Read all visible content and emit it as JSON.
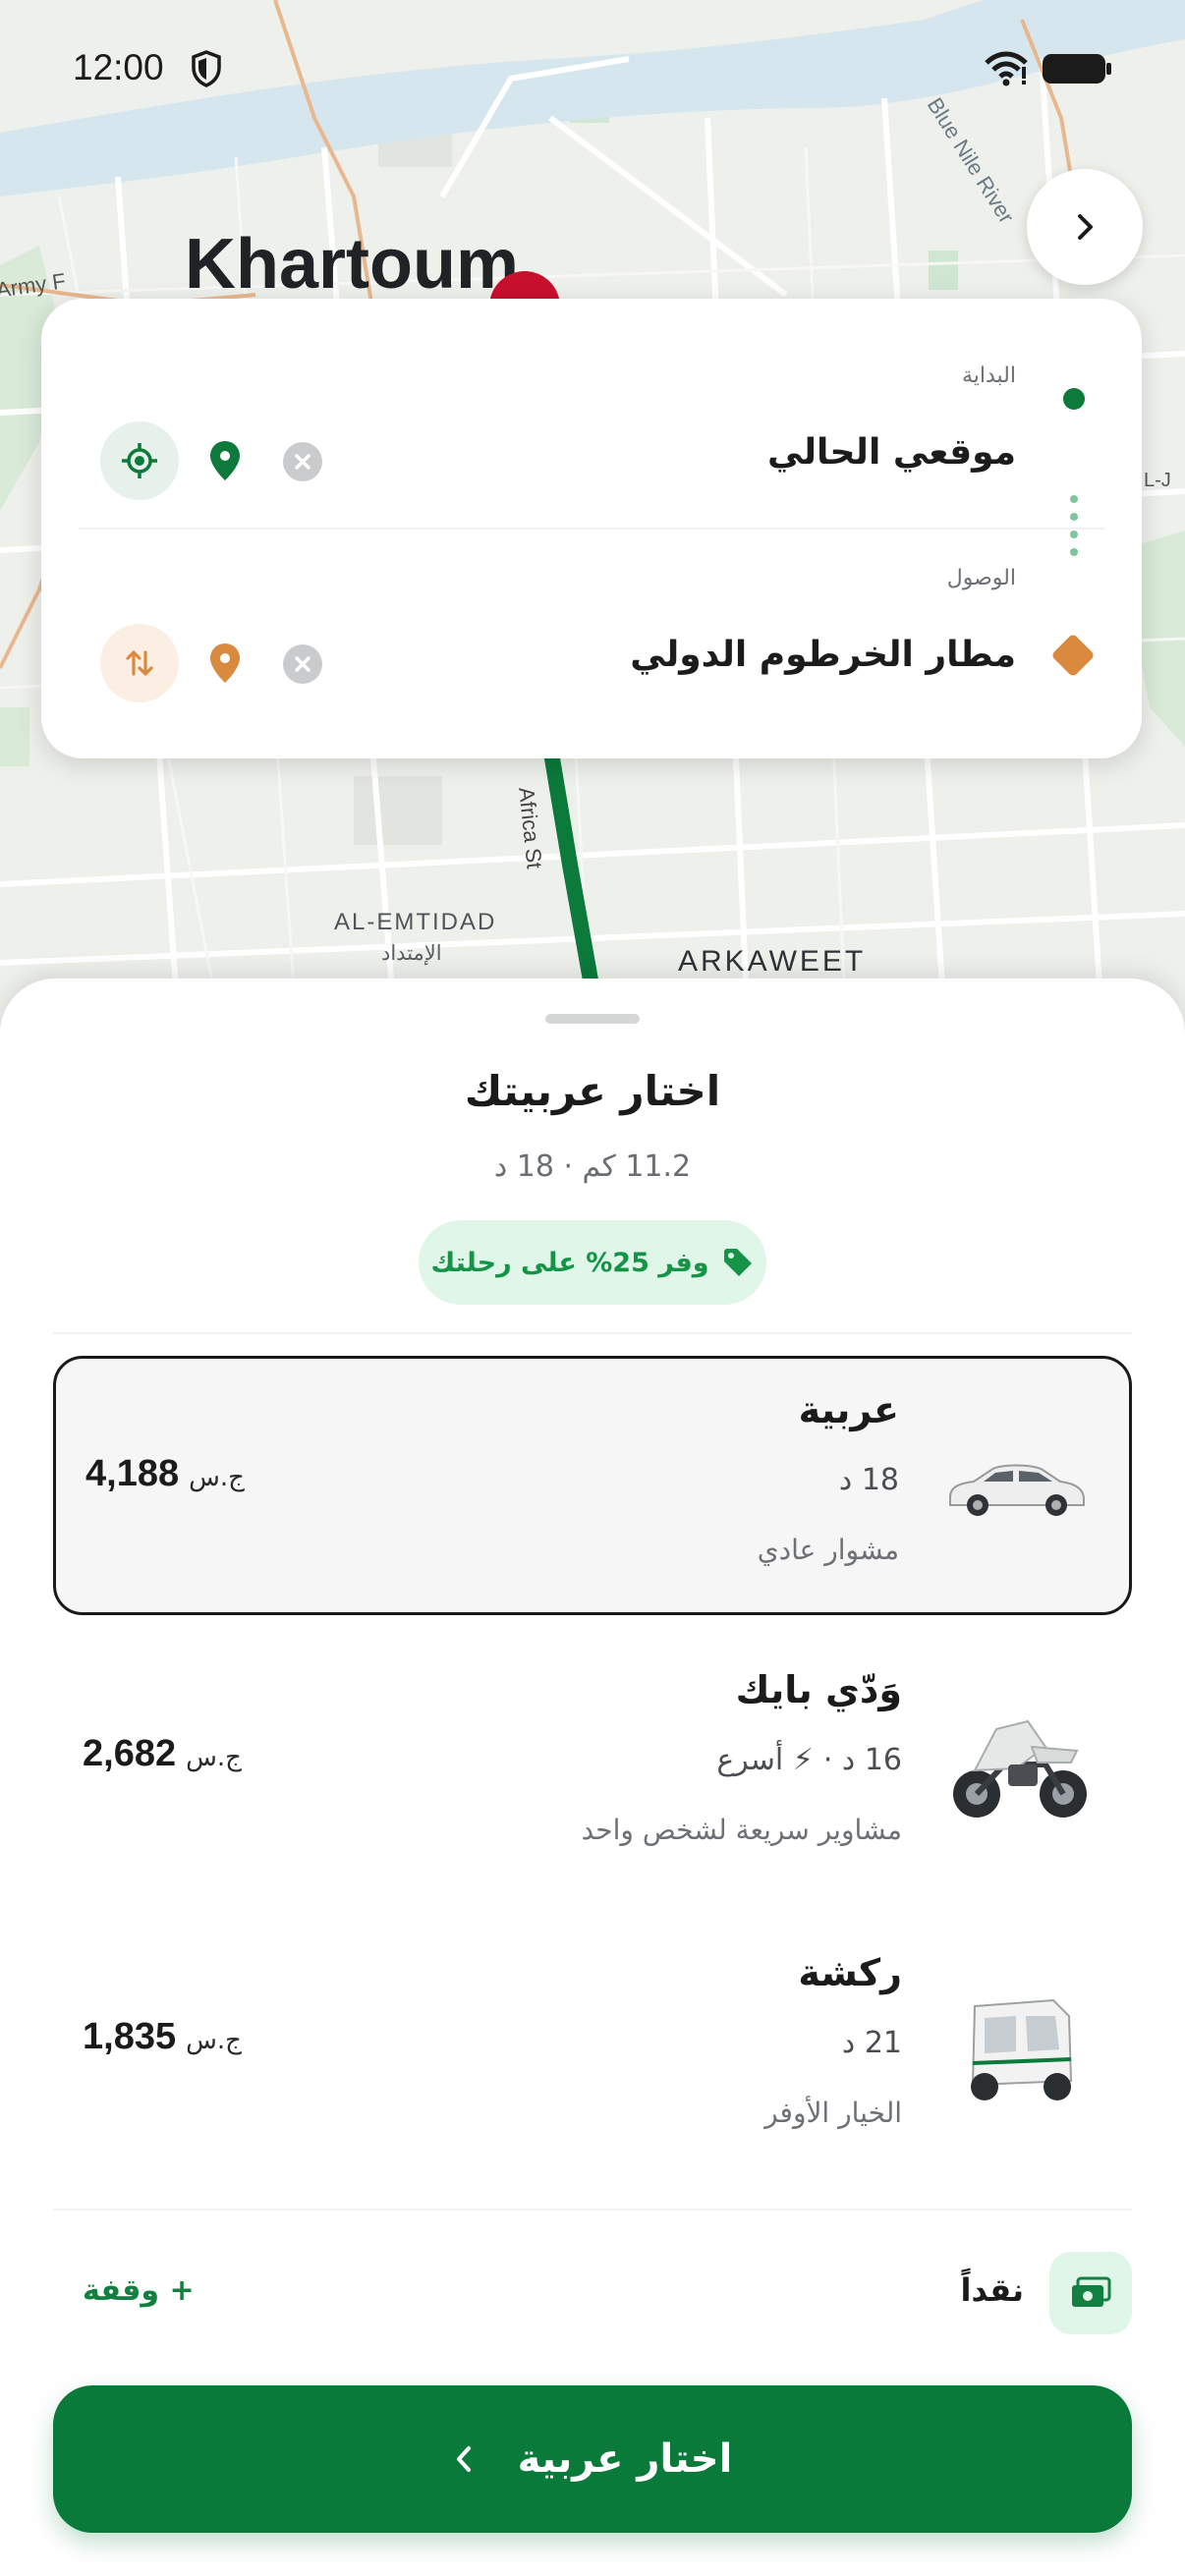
{
  "status_bar": {
    "time": "12:00"
  },
  "map": {
    "city_label": "Khartoum",
    "district_label": "AL-EMTIDAD",
    "district_label_ar": "الإمتداد",
    "area_label": "ARKAWEET",
    "river_label": "Blue Nile River",
    "army_label": "Army F",
    "edge_label": "L-J",
    "street_label": "Africa St"
  },
  "route": {
    "start_label": "البداية",
    "start_value": "موقعي الحالي",
    "dest_label": "الوصول",
    "dest_value": "مطار الخرطوم الدولي"
  },
  "sheet": {
    "title": "اختار عربيتك",
    "trip_meta": "11.2 كم · 18 د",
    "promo": "وفر 25% على رحلتك"
  },
  "vehicles": [
    {
      "name": "عربية",
      "eta": "18 د",
      "badge": "",
      "desc": "مشوار عادي",
      "price": "4,188",
      "currency": "ج.س"
    },
    {
      "name": "وَدّي بايك",
      "eta": "16 د ·",
      "badge": "⚡ أسرع",
      "desc": "مشاوير سريعة لشخص واحد",
      "price": "2,682",
      "currency": "ج.س"
    },
    {
      "name": "ركشة",
      "eta": "21 د",
      "badge": "",
      "desc": "الخيار الأوفر",
      "price": "1,835",
      "currency": "ج.س"
    }
  ],
  "payment": {
    "method": "نقداً",
    "add_stop": "+ وقفة"
  },
  "cta": {
    "label": "اختار عربية"
  },
  "colors": {
    "primary": "#0a7a3b",
    "accent_orange": "#d98a3e",
    "promo_bg": "#e0f6e8"
  }
}
